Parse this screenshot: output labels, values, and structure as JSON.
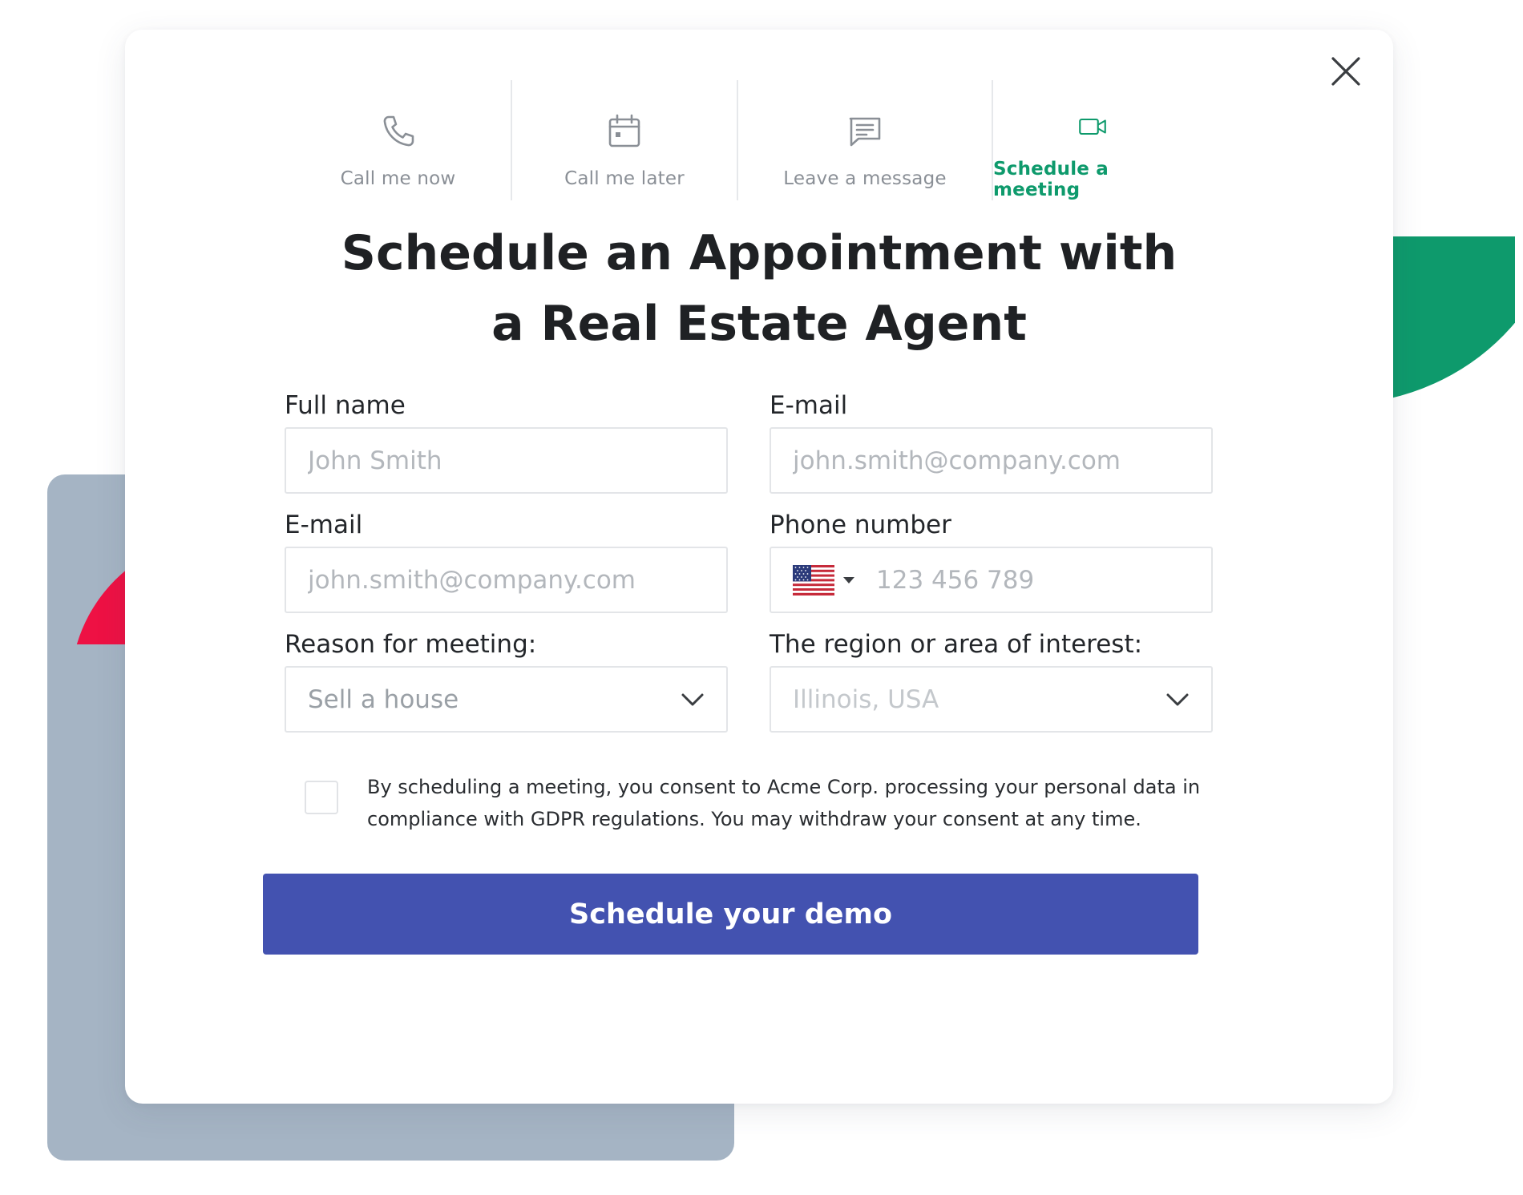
{
  "tabs": [
    {
      "label": "Call me now",
      "icon": "phone-icon",
      "active": false
    },
    {
      "label": "Call me later",
      "icon": "calendar-icon",
      "active": false
    },
    {
      "label": "Leave a message",
      "icon": "message-icon",
      "active": false
    },
    {
      "label": "Schedule a meeting",
      "icon": "video-camera-icon",
      "active": true
    }
  ],
  "title": {
    "line1": "Schedule an Appointment with",
    "line2": "a Real Estate Agent"
  },
  "form": {
    "full_name": {
      "label": "Full name",
      "placeholder": "John Smith"
    },
    "email_right": {
      "label": "E-mail",
      "placeholder": "john.smith@company.com"
    },
    "email_left": {
      "label": "E-mail",
      "placeholder": "john.smith@company.com"
    },
    "phone": {
      "label": "Phone number",
      "placeholder": "123 456 789",
      "country_flag": "us-flag-icon"
    },
    "reason": {
      "label": "Reason for meeting:",
      "value": "Sell a house"
    },
    "region": {
      "label": "The region or area of interest:",
      "value": "Illinois, USA"
    }
  },
  "consent": {
    "checked": false,
    "text": "By scheduling a meeting, you consent to Acme Corp. processing your personal data in compliance with GDPR  regulations. You may withdraw your consent at any time."
  },
  "submit_label": "Schedule your demo",
  "colors": {
    "accent_green": "#0e9a6c",
    "button_blue": "#4352b0",
    "decor_grey": "#a5b4c4",
    "decor_red": "#ee1144"
  }
}
